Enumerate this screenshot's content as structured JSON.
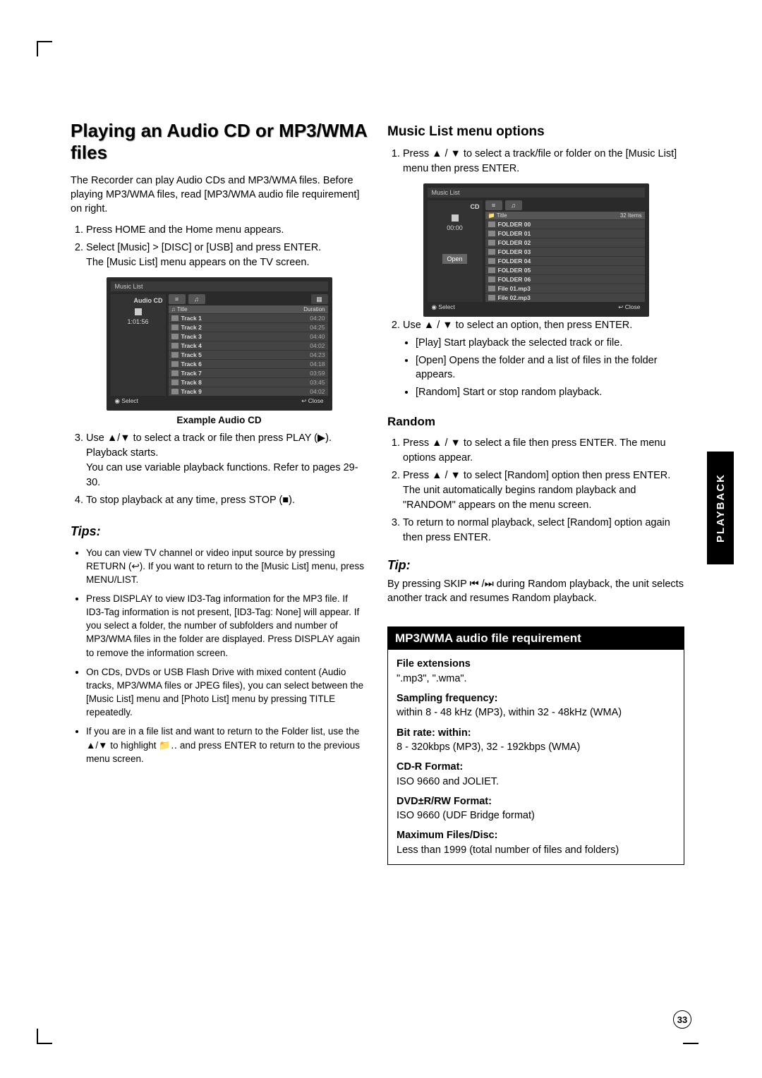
{
  "left": {
    "h1": "Playing an Audio CD or MP3/WMA files",
    "intro": "The Recorder can play Audio CDs and MP3/WMA files. Before playing MP3/WMA files, read [MP3/WMA audio file requirement] on right.",
    "steps12": [
      "Press HOME and the Home menu appears.",
      "Select [Music] > [DISC] or [USB] and press ENTER.\nThe [Music List] menu appears on the TV screen."
    ],
    "ss1": {
      "title": "Music List",
      "left_label": "Audio CD",
      "time": "1:01:56",
      "hdr_title": "Title",
      "hdr_dur": "Duration",
      "tracks": [
        {
          "n": "Track 1",
          "d": "04:20"
        },
        {
          "n": "Track 2",
          "d": "04:25"
        },
        {
          "n": "Track 3",
          "d": "04:40"
        },
        {
          "n": "Track 4",
          "d": "04:02"
        },
        {
          "n": "Track 5",
          "d": "04:23"
        },
        {
          "n": "Track 6",
          "d": "04:18"
        },
        {
          "n": "Track 7",
          "d": "03:59"
        },
        {
          "n": "Track 8",
          "d": "03:45"
        },
        {
          "n": "Track 9",
          "d": "04:02"
        }
      ],
      "foot_l": "◉ Select",
      "foot_r": "↩ Close"
    },
    "caption": "Example Audio CD",
    "step3": "Use ▲/▼ to select a track or file then press PLAY (▶). Playback starts.\nYou can use variable playback functions. Refer to pages 29-30.",
    "step4": "To stop playback at any time, press STOP (■).",
    "tips_h": "Tips:",
    "tips": [
      "You can view TV channel or video input source by pressing RETURN (↩). If you want to return to the [Music List] menu, press MENU/LIST.",
      "Press DISPLAY to view ID3-Tag information for the MP3 file. If ID3-Tag information is not present, [ID3-Tag: None] will appear. If you select a folder, the number of subfolders and number of MP3/WMA files in the folder are displayed. Press DISPLAY again to remove the information screen.",
      "On CDs, DVDs or USB Flash Drive with mixed content (Audio tracks, MP3/WMA files or JPEG files), you can select between the [Music List] menu and [Photo List] menu by pressing TITLE repeatedly.",
      "If you are in a file list and want to return to the Folder list, use the ▲/▼ to highlight 📁‥ and press ENTER to return to the previous menu screen."
    ]
  },
  "right": {
    "h2": "Music List menu options",
    "step1": "Press ▲ / ▼ to select a track/file or folder on the [Music List] menu then press ENTER.",
    "ss2": {
      "title": "Music List",
      "left_label": "CD",
      "time": "00:00",
      "hdr_title": "Title",
      "hdr_count": "32 Items",
      "open": "Open",
      "rows": [
        "FOLDER 00",
        "FOLDER 01",
        "FOLDER 02",
        "FOLDER 03",
        "FOLDER 04",
        "FOLDER 05",
        "FOLDER 06",
        "File 01.mp3",
        "File 02.mp3"
      ],
      "foot_l": "◉ Select",
      "foot_r": "↩ Close"
    },
    "step2": "Use ▲ / ▼ to select an option, then press ENTER.",
    "opts": [
      "[Play] Start playback the selected track or file.",
      "[Open] Opens the folder and a list of files in the folder appears.",
      "[Random] Start or stop random playback."
    ],
    "random_h": "Random",
    "random_steps": [
      "Press ▲ / ▼ to select a file then press ENTER. The menu options appear.",
      "Press ▲ / ▼ to select [Random] option then press ENTER.\nThe unit automatically begins random playback and \"RANDOM\" appears on the menu screen.",
      "To return to normal playback, select [Random] option again then press ENTER."
    ],
    "tip_h": "Tip:",
    "tip_body": "By pressing SKIP ⏮ /⏭ during Random playback, the unit selects another track and resumes Random playback.",
    "req_h": "MP3/WMA audio file requirement",
    "req": [
      {
        "k": "File extensions",
        "v": "\".mp3\", \".wma\"."
      },
      {
        "k": "Sampling frequency:",
        "v": "within 8 - 48 kHz (MP3), within 32 - 48kHz (WMA)"
      },
      {
        "k": "Bit rate: within:",
        "v": "8 - 320kbps (MP3), 32 - 192kbps (WMA)"
      },
      {
        "k": "CD-R Format:",
        "v": "ISO 9660 and JOLIET."
      },
      {
        "k": "DVD±R/RW Format:",
        "v": "ISO 9660 (UDF Bridge format)"
      },
      {
        "k": "Maximum Files/Disc:",
        "v": "Less than 1999 (total number of files and folders)"
      }
    ]
  },
  "side_tab": "PLAYBACK",
  "page": "33"
}
